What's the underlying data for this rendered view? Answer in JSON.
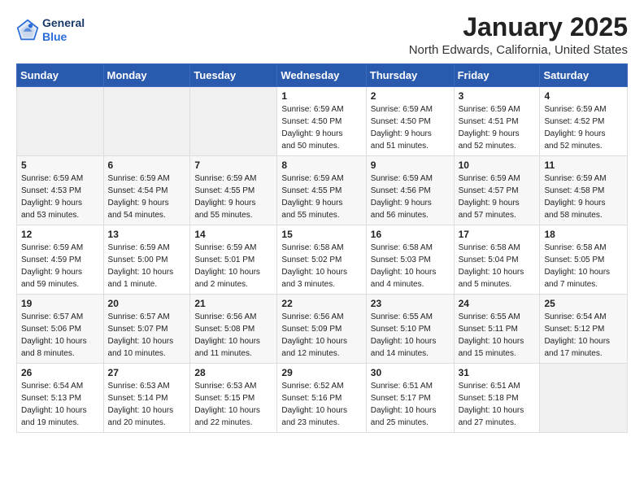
{
  "header": {
    "logo_general": "General",
    "logo_blue": "Blue",
    "title": "January 2025",
    "location": "North Edwards, California, United States"
  },
  "weekdays": [
    "Sunday",
    "Monday",
    "Tuesday",
    "Wednesday",
    "Thursday",
    "Friday",
    "Saturday"
  ],
  "weeks": [
    [
      {
        "day": "",
        "detail": ""
      },
      {
        "day": "",
        "detail": ""
      },
      {
        "day": "",
        "detail": ""
      },
      {
        "day": "1",
        "detail": "Sunrise: 6:59 AM\nSunset: 4:50 PM\nDaylight: 9 hours\nand 50 minutes."
      },
      {
        "day": "2",
        "detail": "Sunrise: 6:59 AM\nSunset: 4:50 PM\nDaylight: 9 hours\nand 51 minutes."
      },
      {
        "day": "3",
        "detail": "Sunrise: 6:59 AM\nSunset: 4:51 PM\nDaylight: 9 hours\nand 52 minutes."
      },
      {
        "day": "4",
        "detail": "Sunrise: 6:59 AM\nSunset: 4:52 PM\nDaylight: 9 hours\nand 52 minutes."
      }
    ],
    [
      {
        "day": "5",
        "detail": "Sunrise: 6:59 AM\nSunset: 4:53 PM\nDaylight: 9 hours\nand 53 minutes."
      },
      {
        "day": "6",
        "detail": "Sunrise: 6:59 AM\nSunset: 4:54 PM\nDaylight: 9 hours\nand 54 minutes."
      },
      {
        "day": "7",
        "detail": "Sunrise: 6:59 AM\nSunset: 4:55 PM\nDaylight: 9 hours\nand 55 minutes."
      },
      {
        "day": "8",
        "detail": "Sunrise: 6:59 AM\nSunset: 4:55 PM\nDaylight: 9 hours\nand 55 minutes."
      },
      {
        "day": "9",
        "detail": "Sunrise: 6:59 AM\nSunset: 4:56 PM\nDaylight: 9 hours\nand 56 minutes."
      },
      {
        "day": "10",
        "detail": "Sunrise: 6:59 AM\nSunset: 4:57 PM\nDaylight: 9 hours\nand 57 minutes."
      },
      {
        "day": "11",
        "detail": "Sunrise: 6:59 AM\nSunset: 4:58 PM\nDaylight: 9 hours\nand 58 minutes."
      }
    ],
    [
      {
        "day": "12",
        "detail": "Sunrise: 6:59 AM\nSunset: 4:59 PM\nDaylight: 9 hours\nand 59 minutes."
      },
      {
        "day": "13",
        "detail": "Sunrise: 6:59 AM\nSunset: 5:00 PM\nDaylight: 10 hours\nand 1 minute."
      },
      {
        "day": "14",
        "detail": "Sunrise: 6:59 AM\nSunset: 5:01 PM\nDaylight: 10 hours\nand 2 minutes."
      },
      {
        "day": "15",
        "detail": "Sunrise: 6:58 AM\nSunset: 5:02 PM\nDaylight: 10 hours\nand 3 minutes."
      },
      {
        "day": "16",
        "detail": "Sunrise: 6:58 AM\nSunset: 5:03 PM\nDaylight: 10 hours\nand 4 minutes."
      },
      {
        "day": "17",
        "detail": "Sunrise: 6:58 AM\nSunset: 5:04 PM\nDaylight: 10 hours\nand 5 minutes."
      },
      {
        "day": "18",
        "detail": "Sunrise: 6:58 AM\nSunset: 5:05 PM\nDaylight: 10 hours\nand 7 minutes."
      }
    ],
    [
      {
        "day": "19",
        "detail": "Sunrise: 6:57 AM\nSunset: 5:06 PM\nDaylight: 10 hours\nand 8 minutes."
      },
      {
        "day": "20",
        "detail": "Sunrise: 6:57 AM\nSunset: 5:07 PM\nDaylight: 10 hours\nand 10 minutes."
      },
      {
        "day": "21",
        "detail": "Sunrise: 6:56 AM\nSunset: 5:08 PM\nDaylight: 10 hours\nand 11 minutes."
      },
      {
        "day": "22",
        "detail": "Sunrise: 6:56 AM\nSunset: 5:09 PM\nDaylight: 10 hours\nand 12 minutes."
      },
      {
        "day": "23",
        "detail": "Sunrise: 6:55 AM\nSunset: 5:10 PM\nDaylight: 10 hours\nand 14 minutes."
      },
      {
        "day": "24",
        "detail": "Sunrise: 6:55 AM\nSunset: 5:11 PM\nDaylight: 10 hours\nand 15 minutes."
      },
      {
        "day": "25",
        "detail": "Sunrise: 6:54 AM\nSunset: 5:12 PM\nDaylight: 10 hours\nand 17 minutes."
      }
    ],
    [
      {
        "day": "26",
        "detail": "Sunrise: 6:54 AM\nSunset: 5:13 PM\nDaylight: 10 hours\nand 19 minutes."
      },
      {
        "day": "27",
        "detail": "Sunrise: 6:53 AM\nSunset: 5:14 PM\nDaylight: 10 hours\nand 20 minutes."
      },
      {
        "day": "28",
        "detail": "Sunrise: 6:53 AM\nSunset: 5:15 PM\nDaylight: 10 hours\nand 22 minutes."
      },
      {
        "day": "29",
        "detail": "Sunrise: 6:52 AM\nSunset: 5:16 PM\nDaylight: 10 hours\nand 23 minutes."
      },
      {
        "day": "30",
        "detail": "Sunrise: 6:51 AM\nSunset: 5:17 PM\nDaylight: 10 hours\nand 25 minutes."
      },
      {
        "day": "31",
        "detail": "Sunrise: 6:51 AM\nSunset: 5:18 PM\nDaylight: 10 hours\nand 27 minutes."
      },
      {
        "day": "",
        "detail": ""
      }
    ]
  ]
}
